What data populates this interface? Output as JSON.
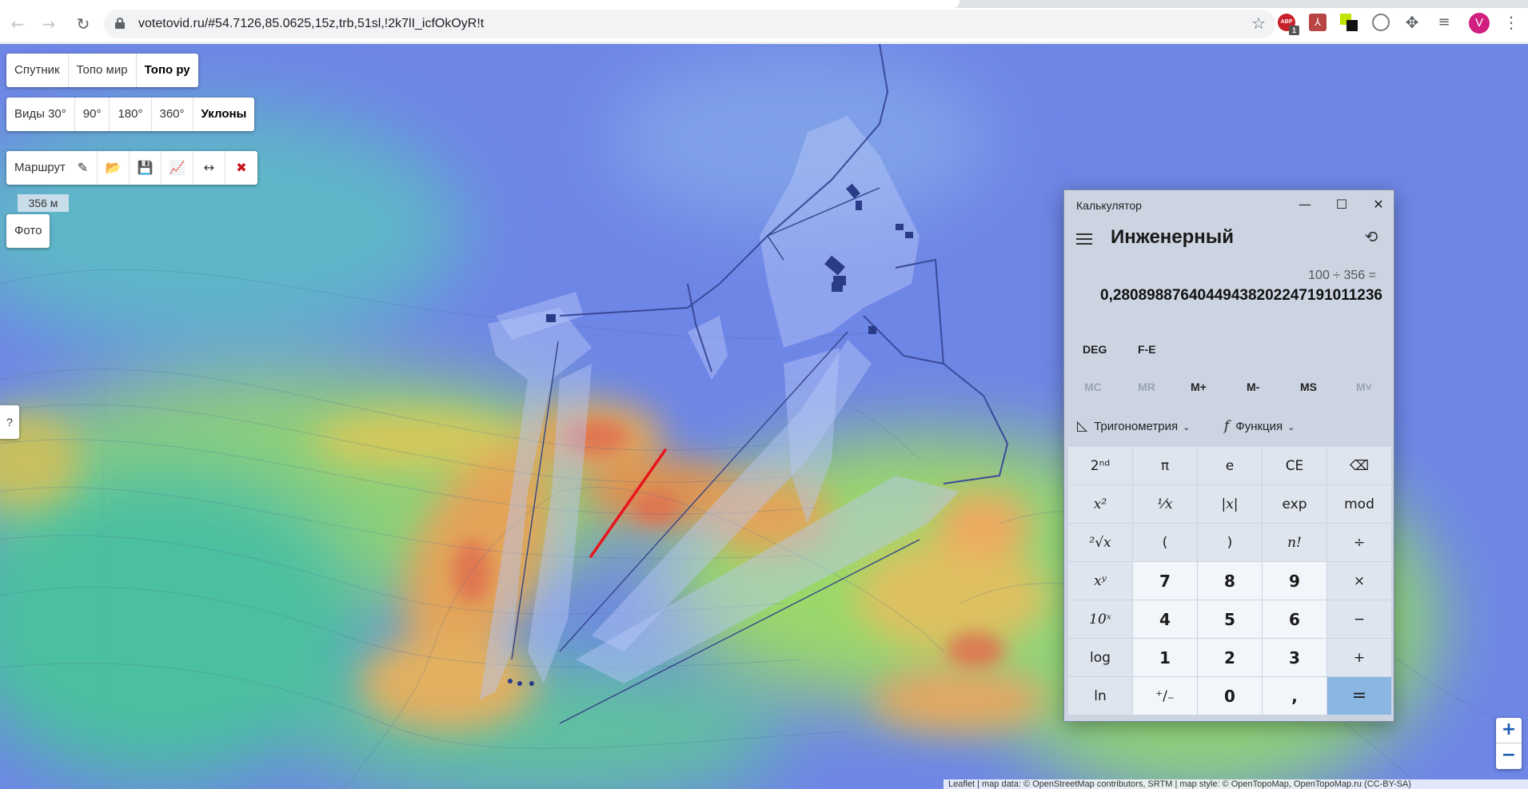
{
  "browser": {
    "url": "votetovid.ru/#54.7126,85.0625,15z,trb,51sl,!2k7lI_icfOkOyR!t",
    "back_icon": "←",
    "forward_icon": "→",
    "reload_icon": "↻",
    "star_icon": "☆",
    "extensions": {
      "abp_label": "ABP",
      "abp_badge": "1",
      "pdf_label": "⅄",
      "puzzle_icon": "✥",
      "media_icon": "≡"
    },
    "profile_initial": "V",
    "menu_icon": "⋮"
  },
  "map": {
    "layers": [
      {
        "label": "Спутник",
        "active": false
      },
      {
        "label": "Топо мир",
        "active": false
      },
      {
        "label": "Топо ру",
        "active": true
      }
    ],
    "views": [
      {
        "label": "Виды 30°",
        "active": false
      },
      {
        "label": "90°",
        "active": false
      },
      {
        "label": "180°",
        "active": false
      },
      {
        "label": "360°",
        "active": false
      },
      {
        "label": "Уклоны",
        "active": true
      }
    ],
    "route": {
      "label": "Маршрут",
      "edit_icon": "✎",
      "open_icon": "📂",
      "save_icon": "💾",
      "profile_icon": "📈",
      "reverse_icon": "↔",
      "delete_icon": "✖"
    },
    "distance": "356 м",
    "photo_label": "Фото",
    "help_label": "?",
    "zoom_in": "+",
    "zoom_out": "−",
    "attribution": "Leaflet | map data: © OpenStreetMap contributors, SRTM | map style: © OpenTopoMap, OpenTopoMap.ru (CC-BY-SA)"
  },
  "calculator": {
    "window_title": "Калькулятор",
    "minimize": "—",
    "maximize": "☐",
    "close": "✕",
    "mode": "Инженерный",
    "history_icon": "⟲",
    "expression": "100 ÷ 356 =",
    "result": "0,280898876404494382022471910112З6",
    "angle_unit": "DEG",
    "fe_label": "F-E",
    "memory": [
      {
        "label": "MC",
        "enabled": false
      },
      {
        "label": "MR",
        "enabled": false
      },
      {
        "label": "M+",
        "enabled": true
      },
      {
        "label": "M-",
        "enabled": true
      },
      {
        "label": "MS",
        "enabled": true
      },
      {
        "label": "M˅",
        "enabled": false
      }
    ],
    "trig_icon": "◺",
    "trig_label": "Тригонометрия",
    "func_icon": "f",
    "func_label": "Функция",
    "chevron": "⌄",
    "keys": [
      "2ⁿᵈ",
      "π",
      "e",
      "CE",
      "⌫",
      "x²",
      "¹⁄x",
      "|x|",
      "exp",
      "mod",
      "²√x",
      "(",
      ")",
      "n!",
      "÷",
      "xʸ",
      "7",
      "8",
      "9",
      "×",
      "10ˣ",
      "4",
      "5",
      "6",
      "−",
      "log",
      "1",
      "2",
      "3",
      "+",
      "ln",
      "⁺∕₋",
      "0",
      ",",
      "="
    ]
  }
}
